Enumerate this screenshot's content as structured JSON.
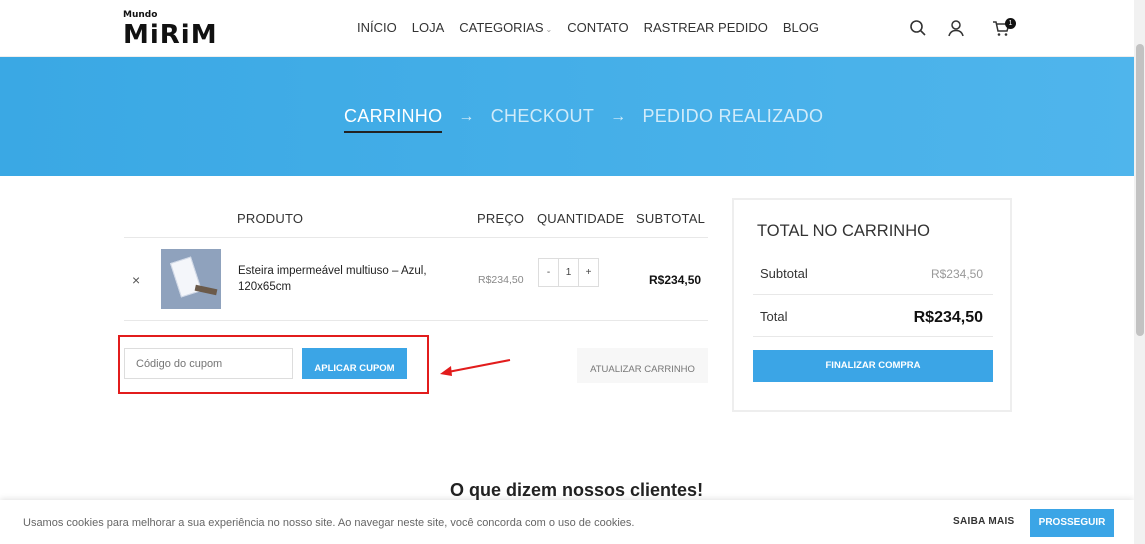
{
  "brand": {
    "logo_small": "Mundo",
    "logo_big": "MiRiM"
  },
  "nav": {
    "items": [
      "INÍCIO",
      "LOJA",
      "CATEGORIAS",
      "CONTATO",
      "RASTREAR PEDIDO",
      "BLOG"
    ],
    "cart_count": "1"
  },
  "steps": {
    "cart": "CARRINHO",
    "checkout": "CHECKOUT",
    "done": "PEDIDO REALIZADO",
    "arrow": "→"
  },
  "table": {
    "headers": {
      "product": "PRODUTO",
      "price": "PREÇO",
      "quantity": "QUANTIDADE",
      "subtotal": "SUBTOTAL"
    },
    "rows": [
      {
        "remove": "×",
        "name": "Esteira impermeável multiuso – Azul, 120x65cm",
        "price": "R$234,50",
        "qty_minus": "-",
        "qty": "1",
        "qty_plus": "+",
        "subtotal": "R$234,50"
      }
    ]
  },
  "coupon": {
    "placeholder": "Código do cupom",
    "apply_label": "APLICAR CUPOM",
    "update_label": "ATUALIZAR CARRINHO"
  },
  "totals": {
    "title": "TOTAL NO CARRINHO",
    "subtotal_label": "Subtotal",
    "subtotal_value": "R$234,50",
    "total_label": "Total",
    "total_value": "R$234,50",
    "checkout_label": "FINALIZAR COMPRA"
  },
  "testimonials": {
    "title": "O que dizem nossos clientes!"
  },
  "cookie": {
    "text": "Usamos cookies para melhorar a sua experiência no nosso site. Ao navegar neste site, você concorda com o uso de cookies.",
    "more_label": "SAIBA MAIS",
    "accept_label": "PROSSEGUIR"
  },
  "colors": {
    "accent": "#3ba5e6",
    "hero": "#45b0ea",
    "annotation": "#e21c1c"
  },
  "icons": [
    "search-icon",
    "user-icon",
    "cart-icon",
    "chevron-down-icon",
    "close-icon",
    "arrow-right-icon"
  ]
}
